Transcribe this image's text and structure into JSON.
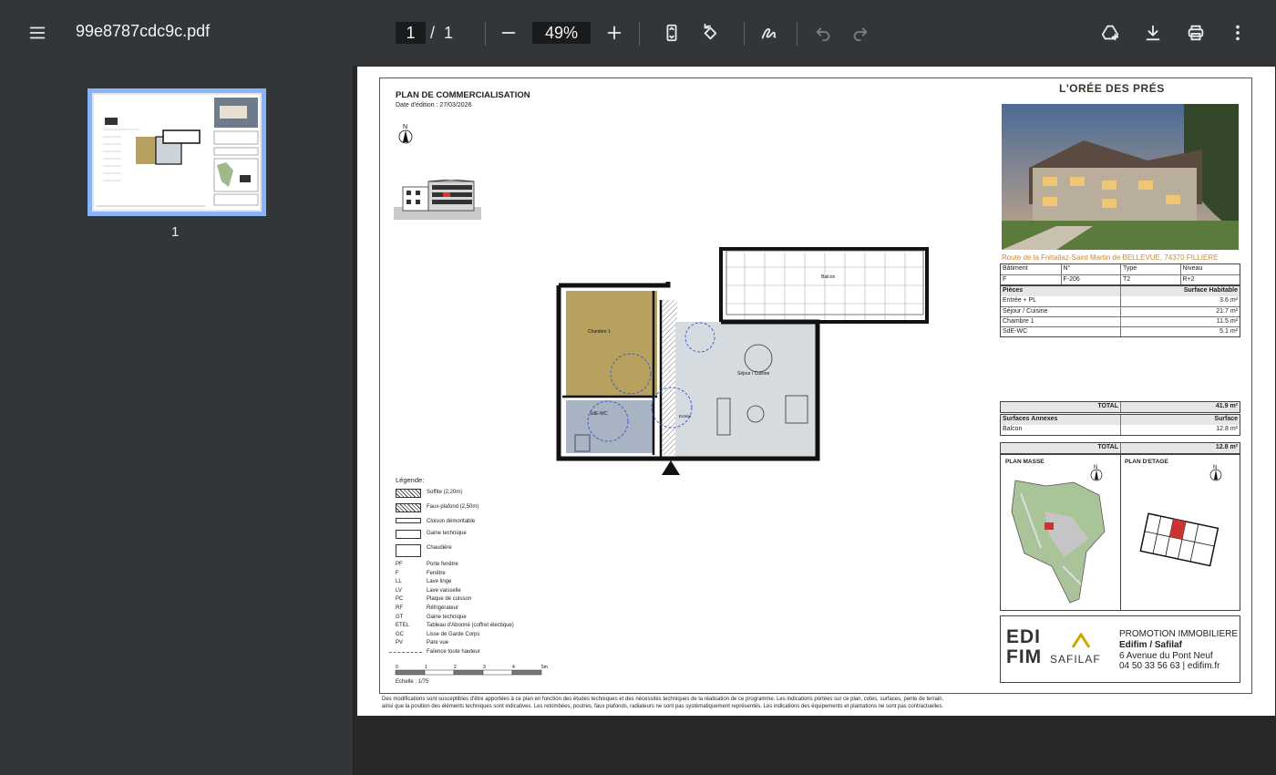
{
  "toolbar": {
    "menu_icon": "hamburger-menu-icon",
    "filename": "99e8787cdc9c.pdf",
    "current_page": "1",
    "page_separator": "/",
    "total_pages": "1",
    "zoom": "49%"
  },
  "sidebar": {
    "thumb_label": "1"
  },
  "doc": {
    "title": "PLAN DE COMMERCIALISATION",
    "edition_date": "Date d'édition :  27/03/2026",
    "brand": "L'ORÉE DES PRÉS",
    "address": "Route de la Frétallaz-Saint Martin de BELLEVUE, 74370 FILLIERE",
    "info_headers": [
      "Bâtiment",
      "N°",
      "Type",
      "Niveau"
    ],
    "info_values": [
      "F",
      "F-206",
      "T2",
      "R+2"
    ],
    "rooms_header": [
      "Pièces",
      "Surface Habitable"
    ],
    "rooms": [
      [
        "Entrée + PL",
        "3.6 m²"
      ],
      [
        "Séjour / Cuisine",
        "21.7 m²"
      ],
      [
        "Chambre 1",
        "11.5 m²"
      ],
      [
        "SdE-WC",
        "5.1 m²"
      ]
    ],
    "total_label": "TOTAL",
    "total_value": "41.9 m²",
    "annex_header": [
      "Surfaces Annexes",
      "Surface"
    ],
    "annex": [
      [
        "Balcon",
        "12.8 m²"
      ]
    ],
    "annex_total_label": "TOTAL",
    "annex_total_value": "12.8 m²",
    "plan_masse": "PLAN MASSE",
    "plan_etage": "PLAN D'ETAGE",
    "promo_title": "PROMOTION IMMOBILIERE",
    "promo_name": "Edifim / Safilaf",
    "promo_address": "6 Avenue du Pont Neuf",
    "promo_contact": "04 50 33 56 63 | edifim.fr",
    "logo_edifim": "EDIFIM",
    "logo_safilaf": "SAFILAF",
    "legend_title": "Légende:",
    "legend_hatch": [
      [
        "Soffite (2,20m)"
      ],
      [
        "Faux-plafond (2,50m)"
      ],
      [
        "Cloison démontable"
      ],
      [
        "Gaine technique"
      ],
      [
        "Chaudière"
      ]
    ],
    "legend_abbr": [
      [
        "PF",
        "Porte fenêtre"
      ],
      [
        "F",
        "Fenêtre"
      ],
      [
        "LL",
        "Lave linge"
      ],
      [
        "LV",
        "Lave vaisselle"
      ],
      [
        "PC",
        "Plaque de cuisson"
      ],
      [
        "RF",
        "Réfrigérateur"
      ],
      [
        "GT",
        "Gaine technique"
      ],
      [
        "ETEL",
        "Tableau d'Abonné (coffret électique)"
      ],
      [
        "GC",
        "Lisse de Garde Corps"
      ],
      [
        "PV",
        "Pare vue"
      ],
      [
        "",
        "Faïence toute hauteur"
      ]
    ],
    "scale_ticks": [
      "0",
      "1",
      "2",
      "3",
      "4",
      "5m"
    ],
    "scale_label": "Echelle : 1/75",
    "plan_labels": {
      "chambre": "Chambre 1",
      "sdewc": "SdE-WC",
      "entree": "Entrée",
      "sejour": "Séjour / Cuisine",
      "balcon": "Balcon"
    },
    "disclaimer_1": "Des modifications sont susceptibles d'être apportées à ce plan en fonction des études techniques et des nécessités techniques de la réalisation de ce programme.   Les indications portées sur ce plan, cotes, surfaces, pente de terrain,",
    "disclaimer_2": "ainsi que la position des éléments techniques sont indicatives.  Les retombées, poutres, faux plafonds, radiateurs ne sont pas systématiquement représentés. Les indications des équipements et plantations ne sont pas contractuelles."
  }
}
